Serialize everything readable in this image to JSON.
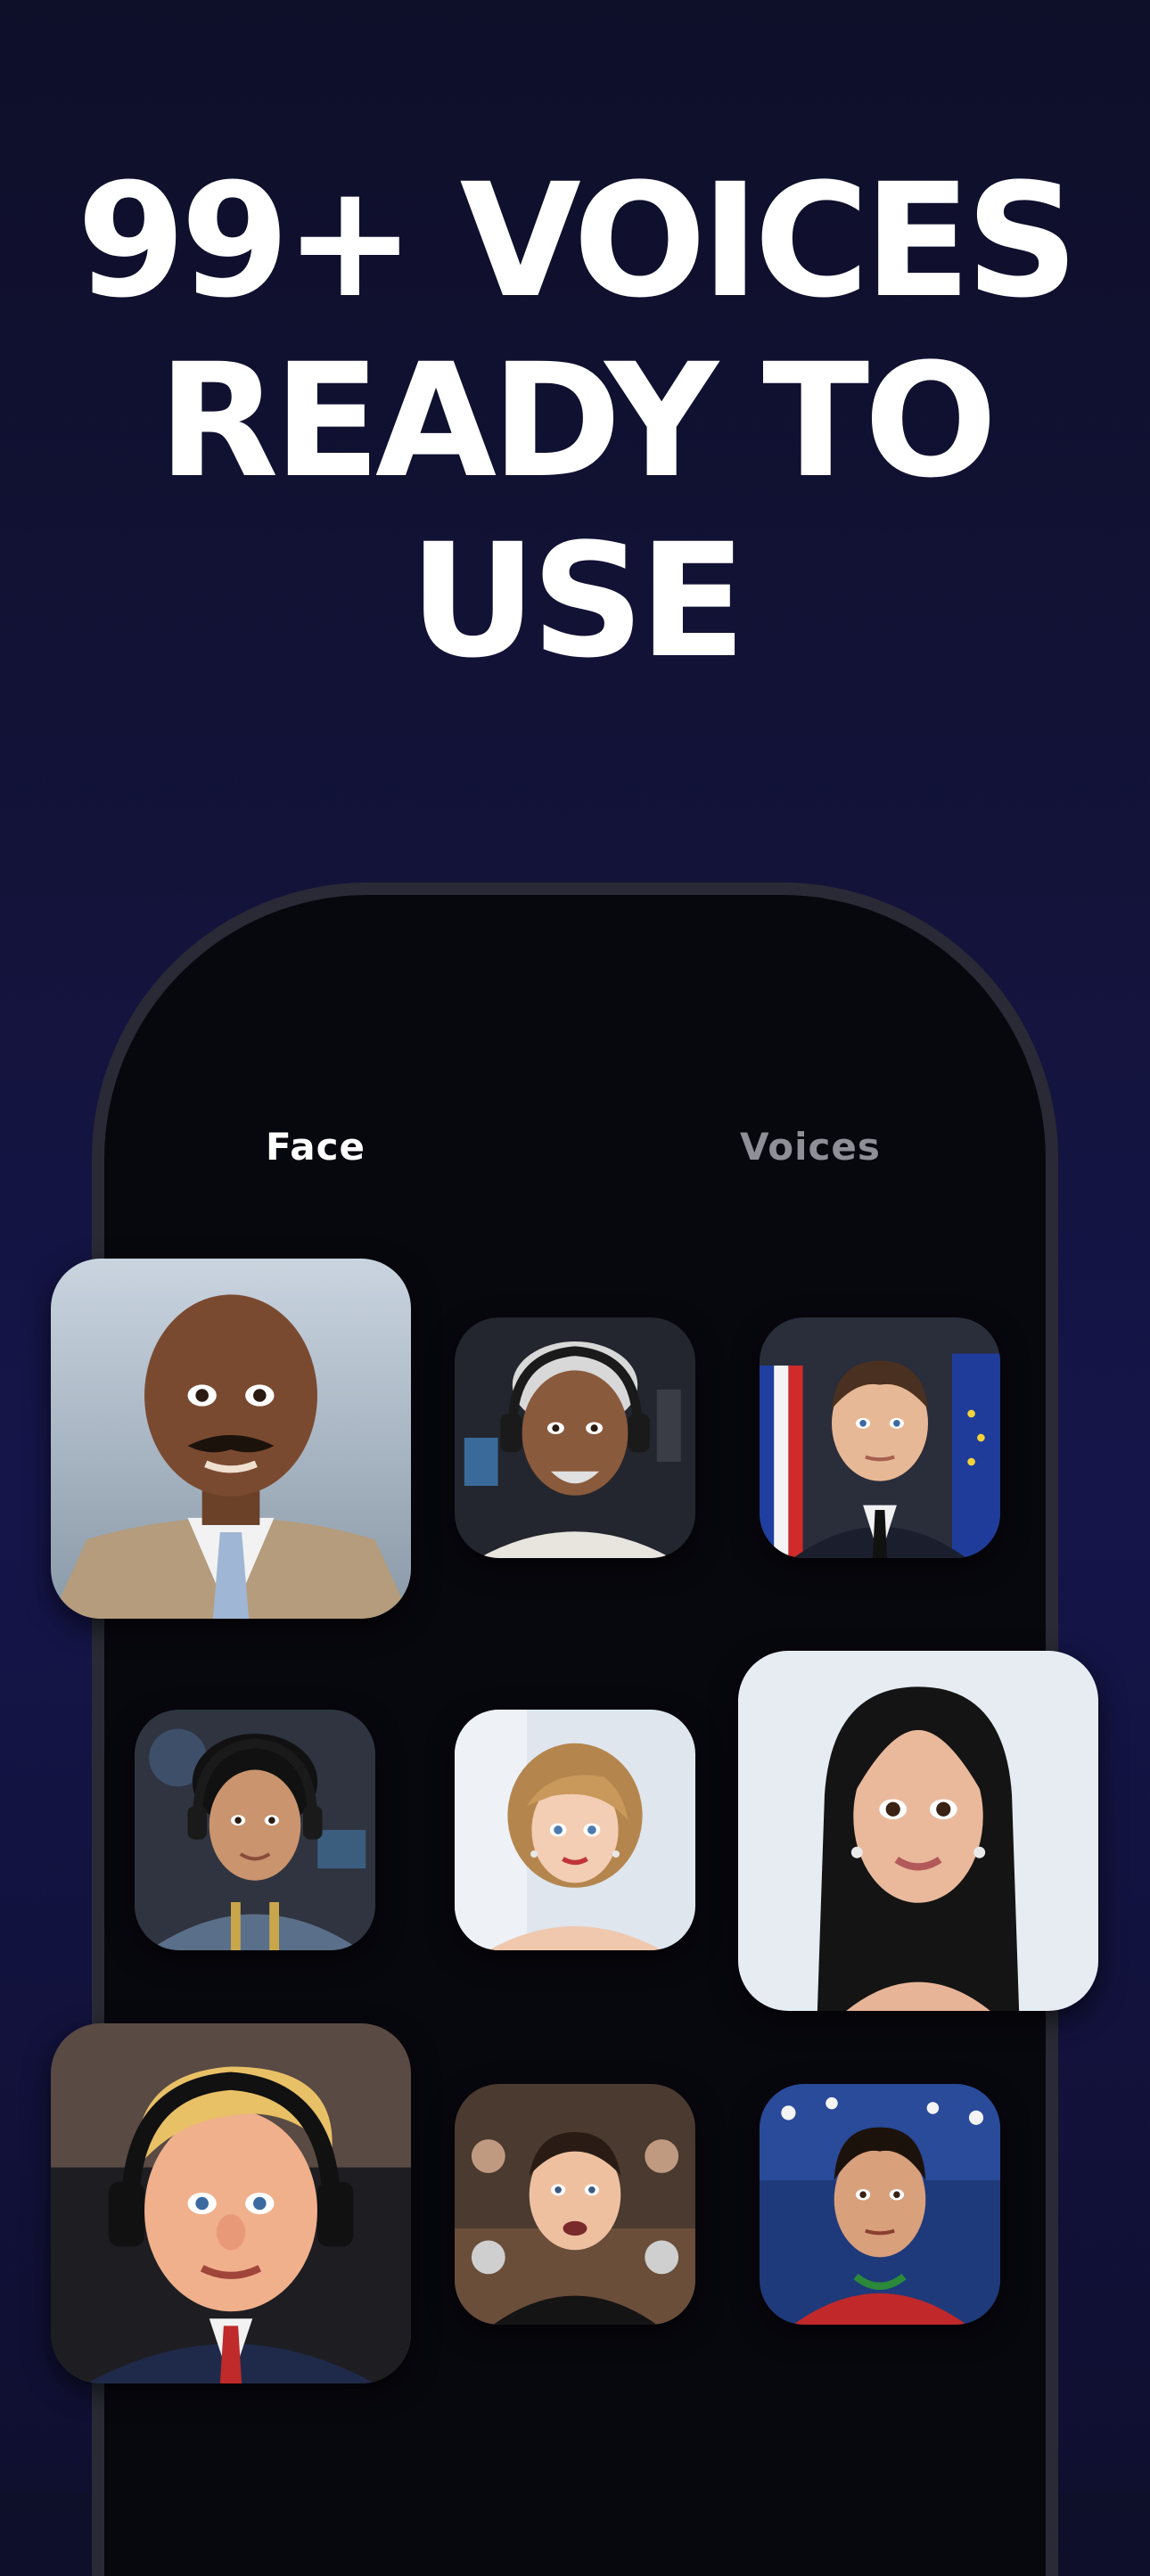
{
  "headline": {
    "line1": "99+ VOICES",
    "line2": "READY TO",
    "line3": "USE"
  },
  "tabs": {
    "face": "Face",
    "voices": "Voices"
  },
  "colors": {
    "background": "#13133a",
    "phone_body": "#07070e",
    "phone_frame": "#2a2a36",
    "tab_active": "#ffffff",
    "tab_inactive": "#8f8f98"
  },
  "avatars": [
    {
      "icon": "bald-man-mustache-avatar"
    },
    {
      "icon": "gray-haired-man-headphones-avatar"
    },
    {
      "icon": "man-suit-flags-avatar"
    },
    {
      "icon": "curly-hair-man-headphones-avatar"
    },
    {
      "icon": "blonde-bob-woman-avatar"
    },
    {
      "icon": "long-dark-hair-woman-avatar"
    },
    {
      "icon": "blonde-man-headphones-avatar"
    },
    {
      "icon": "man-dark-shirt-avatar"
    },
    {
      "icon": "soccer-player-avatar"
    }
  ]
}
